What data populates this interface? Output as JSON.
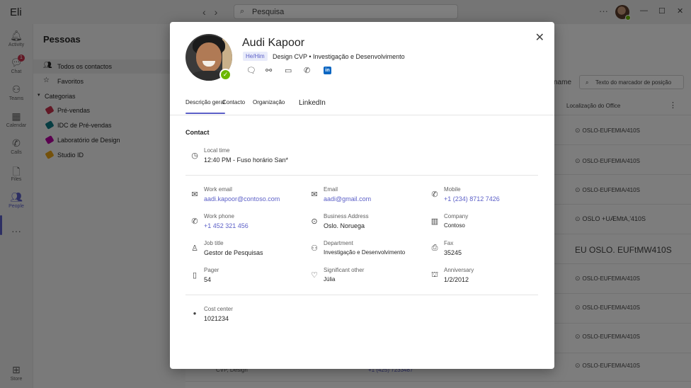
{
  "app": {
    "name": "Eli"
  },
  "search": {
    "placeholder": "Pesquisa"
  },
  "rail": [
    {
      "label": "Activity",
      "icon": "bell-icon"
    },
    {
      "label": "Chat",
      "icon": "chat-icon",
      "badge": "1"
    },
    {
      "label": "Teams",
      "icon": "teams-icon"
    },
    {
      "label": "Calendar",
      "icon": "calendar-icon"
    },
    {
      "label": "Calls",
      "icon": "phone-icon"
    },
    {
      "label": "Files",
      "icon": "file-icon"
    },
    {
      "label": "People",
      "icon": "people-icon"
    },
    {
      "label": "Store",
      "icon": "store-icon"
    }
  ],
  "sidebar": {
    "title": "Pessoas",
    "items": [
      "Todos os contactos",
      "Favoritos"
    ],
    "categories_label": "Categorias",
    "categories": [
      {
        "label": "Pré-vendas",
        "color": "#c4314b"
      },
      {
        "label": "IDC de Pré-vendas",
        "color": "#0f7b84"
      },
      {
        "label": "Laboratório de Design",
        "color": "#b4009e"
      },
      {
        "label": "Studio ID",
        "color": "#e8a317"
      }
    ]
  },
  "list": {
    "name_header": "name",
    "filter_placeholder": "Texto do marcador de posição",
    "location_header": "Localização do Office",
    "locations": [
      "OSLO-EUFEMIA/410S",
      "OSLO-EUFEMIA/410S",
      "OSLO-EUFEMIA/410S",
      "OSLO +UÆMtA,'410S",
      "EU OSLO. EUFtMW410S",
      "OSLO-EUFEMIA/410S",
      "OSLO-EUFEMIA/410S",
      "OSLO-EUFEMIA/410S",
      "OSLO-EUFEMIA/410S"
    ],
    "bottom_row": {
      "title": "CVP, Design",
      "phone": "+1 (425) 7233487"
    }
  },
  "card": {
    "name": "Audi Kapoor",
    "pronouns": "He/Him",
    "title": "Design CVP • Investigação e Desenvolvimento",
    "tabs": [
      "Descrição geral",
      "Contacto",
      "Organização",
      "LinkedIn"
    ],
    "section": "Contact",
    "local_time": {
      "label": "Local time",
      "value": "12:40 PM - Fuso horário San*"
    },
    "fields": {
      "work_email": {
        "label": "Work email",
        "value": "aadi.kapoor@contoso.com"
      },
      "email": {
        "label": "Email",
        "value": "aadi@gmail.com"
      },
      "mobile": {
        "label": "Mobile",
        "value": "+1 (234) 8712 7426"
      },
      "work_phone": {
        "label": "Work phone",
        "value": "+1 452 321 456"
      },
      "business_address": {
        "label": "Business Address",
        "value": "Oslo. Noruega"
      },
      "company": {
        "label": "Company",
        "value": "Contoso"
      },
      "job_title": {
        "label": "Job title",
        "value": "Gestor de Pesquisas"
      },
      "department": {
        "label": "Department",
        "value": "Investigação e Desenvolvimento"
      },
      "fax": {
        "label": "Fax",
        "value": "35245"
      },
      "pager": {
        "label": "Pager",
        "value": "54"
      },
      "significant_other": {
        "label": "Significant other",
        "value": "Júlia"
      },
      "anniversary": {
        "label": "Anniversary",
        "value": "1/2/2012"
      },
      "cost_center": {
        "label": "Cost center",
        "value": "1021234"
      }
    }
  }
}
